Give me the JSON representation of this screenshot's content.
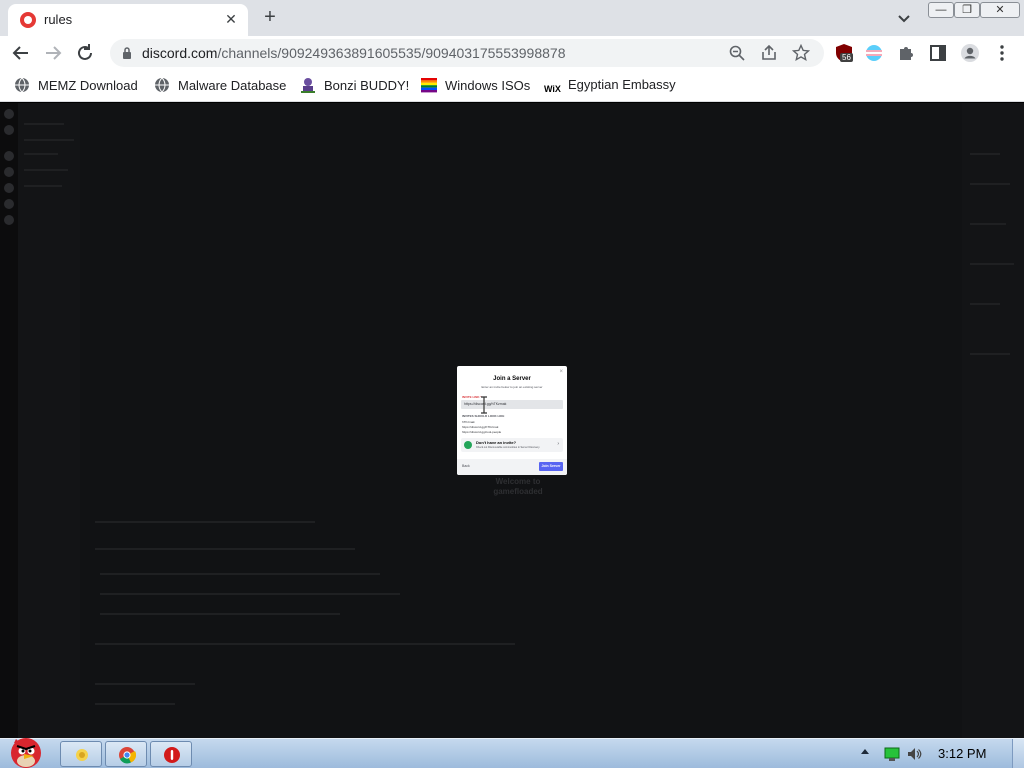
{
  "tab": {
    "title": "rules",
    "close": "✕"
  },
  "new_tab": "+",
  "window_controls": {
    "minimize": "—",
    "maximize": "❐",
    "close": "✕"
  },
  "omnibox": {
    "domain": "discord.com",
    "path": "/channels/909249363891605535/909403175553998878"
  },
  "extensions": {
    "badge": "56"
  },
  "bookmarks": [
    {
      "label": "MEMZ Download",
      "icon": "globe-icon"
    },
    {
      "label": "Malware Database",
      "icon": "globe-icon"
    },
    {
      "label": "Bonzi BUDDY!",
      "icon": "bonzi-icon"
    },
    {
      "label": "Windows ISOs",
      "icon": "rainbow-flag-icon"
    },
    {
      "label": "Egyptian Embassy",
      "icon": "wix-icon"
    }
  ],
  "modal": {
    "title": "Join a Server",
    "subtitle": "Enter an invite below to join an existing server",
    "label": "INVITE LINK *",
    "input_value": "https://discord.gg/hTKzmak",
    "invites_header": "INVITES SHOULD LOOK LIKE",
    "invites": [
      "hTKzmak",
      "https://discord.gg/hTKzmak",
      "https://discord.gg/cool-people"
    ],
    "card_title": "Don't have an invite?",
    "card_subtitle": "Check out Discoverable communities in Server Discovery.",
    "back": "Back",
    "join": "Join Server",
    "close": "×"
  },
  "background": {
    "welcome": "Welcome to gamefloaded"
  },
  "taskbar": {
    "clock": "3:12 PM"
  }
}
